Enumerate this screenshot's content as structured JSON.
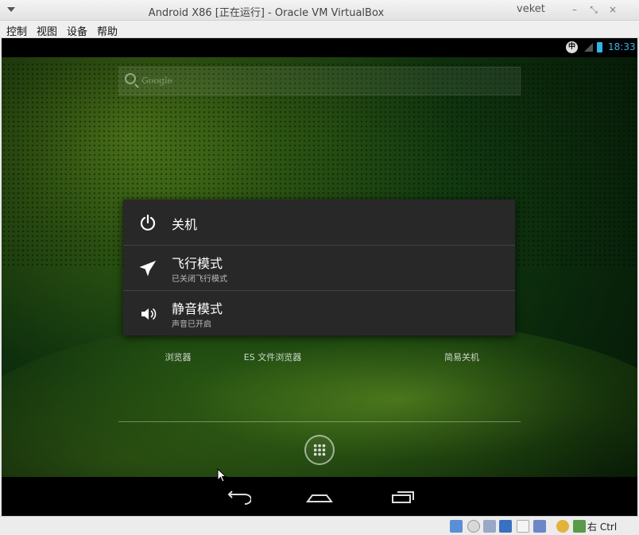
{
  "window": {
    "title": "Android X86 [正在运行] - Oracle VM VirtualBox",
    "user": "veket",
    "minimize": "–",
    "restore": "⤡",
    "close": "×"
  },
  "menu": {
    "items": [
      "控制",
      "视图",
      "设备",
      "帮助"
    ]
  },
  "android": {
    "status_bar": {
      "ime": "中",
      "time": "18:33"
    },
    "search": {
      "hint": "Google"
    },
    "apps": [
      {
        "label": "浏览器"
      },
      {
        "label": "ES 文件浏览器"
      },
      {
        "label": "简易关机"
      }
    ],
    "power_dialog": {
      "items": [
        {
          "label": "关机",
          "sub": ""
        },
        {
          "label": "飞行模式",
          "sub": "已关闭飞行模式"
        },
        {
          "label": "静音模式",
          "sub": "声音已开启"
        }
      ]
    }
  },
  "tray": {
    "host_key": "右 Ctrl"
  },
  "colors": {
    "accent": "#33b5e5",
    "dialog_bg": "#282828"
  }
}
